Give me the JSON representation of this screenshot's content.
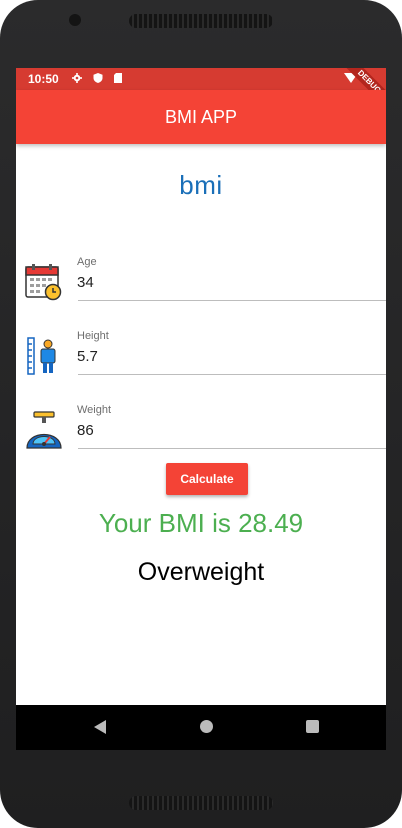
{
  "status_bar": {
    "time": "10:50",
    "debug_banner": "DEBUG"
  },
  "app_bar": {
    "title": "BMI APP"
  },
  "logo": {
    "text": "bmi"
  },
  "form": {
    "age": {
      "label": "Age",
      "value": "34"
    },
    "height": {
      "label": "Height",
      "value": "5.7"
    },
    "weight": {
      "label": "Weight",
      "value": "86"
    }
  },
  "actions": {
    "calculate_label": "Calculate"
  },
  "result": {
    "bmi_text": "Your BMI is 28.49",
    "category": "Overweight"
  },
  "colors": {
    "primary": "#f44336",
    "status_bar": "#d63b31",
    "result": "#4caf50",
    "logo": "#1a6fb8"
  }
}
